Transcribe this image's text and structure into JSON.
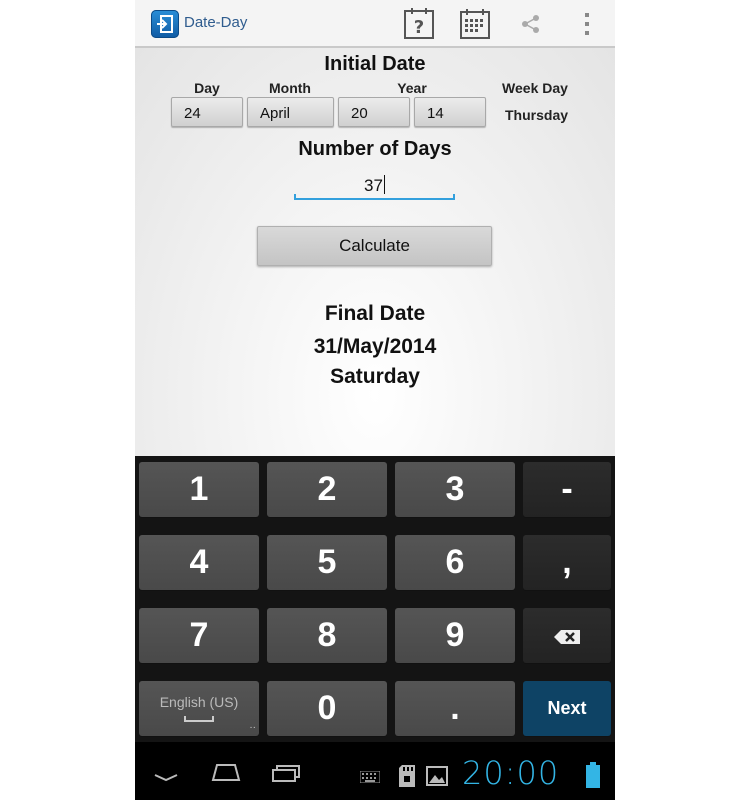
{
  "app": {
    "title": "Date-Day",
    "action_icons": [
      "help-icon",
      "calendar-icon",
      "share-icon",
      "overflow-menu-icon"
    ]
  },
  "initial_date": {
    "heading": "Initial Date",
    "labels": {
      "day": "Day",
      "month": "Month",
      "year": "Year",
      "week_day": "Week Day"
    },
    "values": {
      "day": "24",
      "month": "April",
      "year_century": "20",
      "year_short": "14",
      "week_day": "Thursday"
    }
  },
  "number_of_days": {
    "heading": "Number of Days",
    "value": "37"
  },
  "calculate_label": "Calculate",
  "final_date": {
    "heading": "Final Date",
    "date": "31/May/2014",
    "week_day": "Saturday"
  },
  "keyboard": {
    "rows": [
      [
        "1",
        "2",
        "3",
        "-"
      ],
      [
        "4",
        "5",
        "6",
        ","
      ],
      [
        "7",
        "8",
        "9",
        "backspace"
      ],
      [
        "English (US)",
        "0",
        ".",
        "Next"
      ]
    ],
    "language_label": "English (US)",
    "next_label": "Next"
  },
  "status": {
    "clock": "20:00"
  },
  "colors": {
    "accent": "#33b5e5",
    "next_key": "#0e4365",
    "title_blue": "#2f5c8e"
  }
}
